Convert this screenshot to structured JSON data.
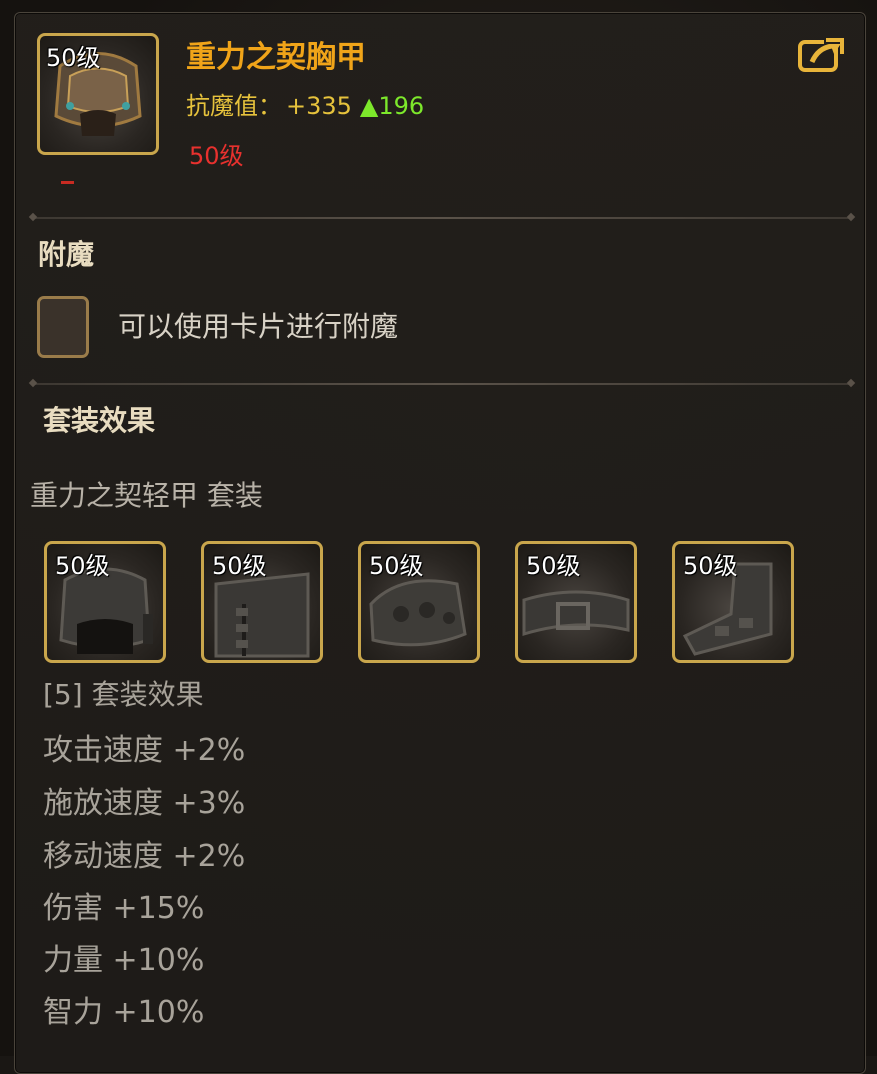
{
  "item": {
    "name": "重力之契胸甲",
    "icon": "chest-armor-icon",
    "level_badge": "50级",
    "stat_label": "抗魔值：",
    "stat_value": "+335",
    "stat_up": "▲196",
    "required_level": "50级"
  },
  "share": {
    "icon": "share-icon"
  },
  "enchant": {
    "title": "附魔",
    "hint": "可以使用卡片进行附魔"
  },
  "set": {
    "title": "套装效果",
    "name": "重力之契轻甲 套装",
    "pieces": [
      {
        "level": "50级",
        "icon": "chest-armor-icon"
      },
      {
        "level": "50级",
        "icon": "pants-armor-icon"
      },
      {
        "level": "50级",
        "icon": "shoulder-armor-icon"
      },
      {
        "level": "50级",
        "icon": "belt-armor-icon"
      },
      {
        "level": "50级",
        "icon": "boots-armor-icon"
      }
    ],
    "bonus_header": "[5] 套装效果",
    "bonuses": [
      "攻击速度 +2%",
      "施放速度 +3%",
      "移动速度 +2%",
      "伤害 +15%",
      "力量 +10%",
      "智力 +10%"
    ]
  },
  "colors": {
    "item_name": "#f0a419",
    "stat": "#e6c23c",
    "stat_up": "#7de82b",
    "required_level": "#e8312e",
    "slot_border": "#c9a64c"
  }
}
